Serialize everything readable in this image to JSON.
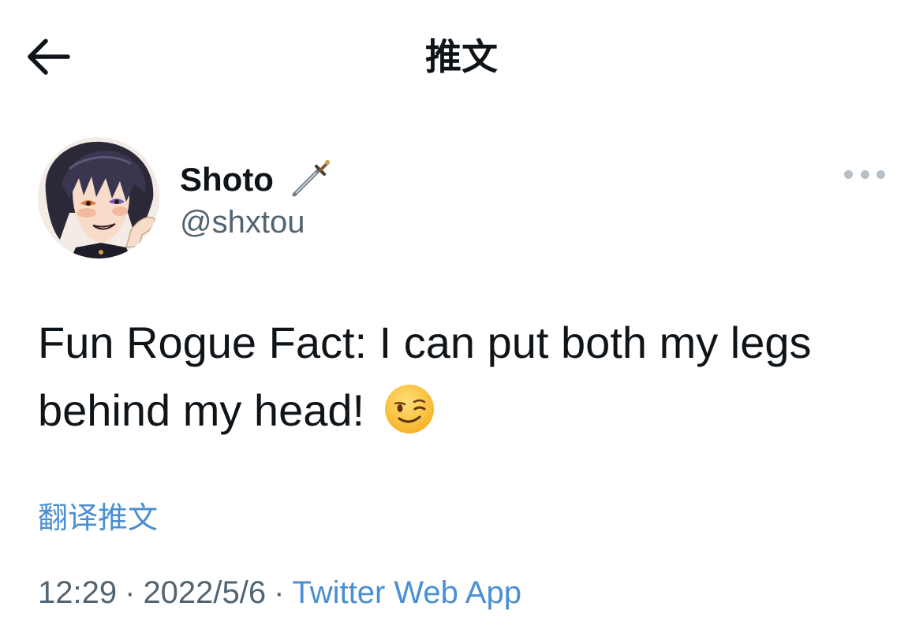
{
  "header": {
    "back_icon": "arrow-left-icon",
    "title": "推文"
  },
  "tweet": {
    "author": {
      "display_name": "Shoto",
      "name_emoji": "dagger-icon",
      "handle": "@shxtou",
      "avatar": "avatar-image"
    },
    "more_icon": "more-horizontal-icon",
    "text": "Fun Rogue Fact: I can put both my legs behind my head!",
    "text_emoji": "winking-face-icon",
    "translate_label": "翻译推文",
    "time": "12:29",
    "separator": "·",
    "date": "2022/5/6",
    "source": "Twitter Web App"
  },
  "colors": {
    "text_primary": "#0f1419",
    "text_secondary": "#536471",
    "link": "#4a8fd1",
    "more_dots": "#b6c0c9"
  }
}
